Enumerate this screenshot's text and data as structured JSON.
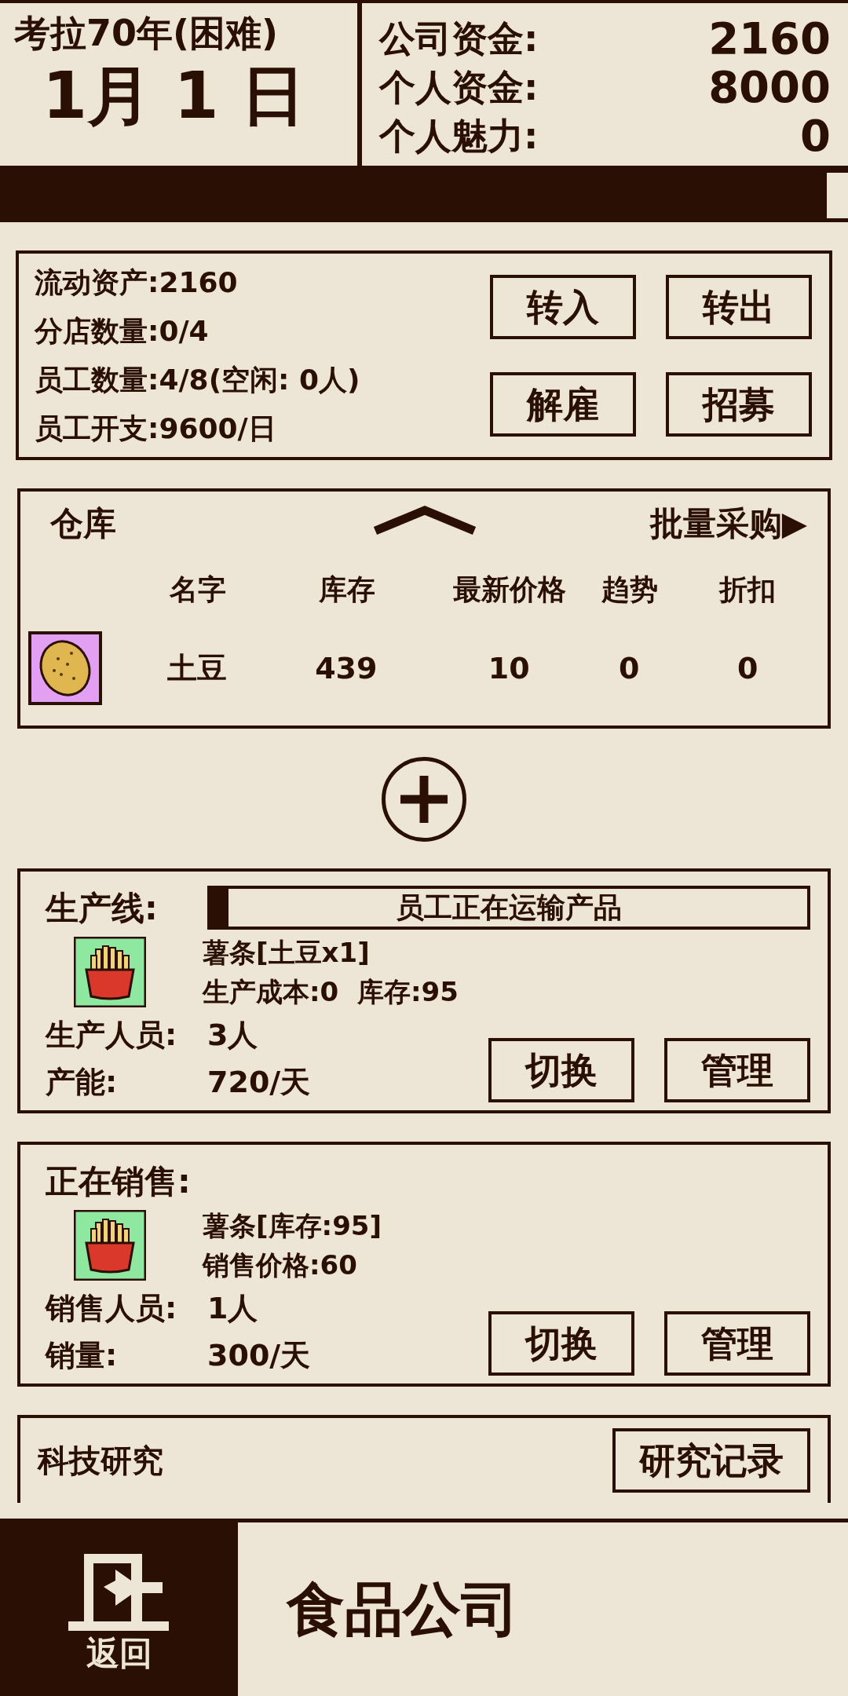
{
  "header": {
    "title": "考拉70年(困难)",
    "date": "1月 1 日",
    "stats": [
      {
        "label": "公司资金:",
        "value": "2160"
      },
      {
        "label": "个人资金:",
        "value": "8000"
      },
      {
        "label": "个人魅力:",
        "value": "0"
      }
    ]
  },
  "day_progress": {
    "level": 0.975
  },
  "finance": {
    "lines": [
      "流动资产:2160",
      "分店数量:0/4",
      "员工数量:4/8(空闲: 0人)",
      "员工开支:9600/日"
    ],
    "buttons": [
      "转入",
      "转出",
      "解雇",
      "招募"
    ]
  },
  "warehouse": {
    "title": "仓库",
    "bulk_buy": "批量采购▶",
    "expanded": true,
    "columns": [
      "名字",
      "库存",
      "最新价格",
      "趋势",
      "折扣"
    ],
    "rows": [
      {
        "cells": [
          "土豆",
          "439",
          "10",
          "0",
          "0"
        ]
      }
    ]
  },
  "production": {
    "title": "生产线:",
    "status": "员工正在运输产品",
    "level": 0.03,
    "product": "薯条[土豆x1]",
    "detail": "生产成本:0  库存:95",
    "stats": [
      {
        "label": "生产人员:",
        "value": "3人"
      },
      {
        "label": "产能:",
        "value": "720/天"
      }
    ],
    "buttons": [
      "切换",
      "管理"
    ]
  },
  "sales": {
    "title": "正在销售:",
    "product": "薯条[库存:95]",
    "detail": "销售价格:60",
    "stats": [
      {
        "label": "销售人员:",
        "value": "1人"
      },
      {
        "label": "销量:",
        "value": "300/天"
      }
    ],
    "buttons": [
      "切换",
      "管理"
    ]
  },
  "research": {
    "title": "科技研究",
    "button": "研究记录"
  },
  "bottom_bar": {
    "back": "返回",
    "title": "食品公司"
  }
}
